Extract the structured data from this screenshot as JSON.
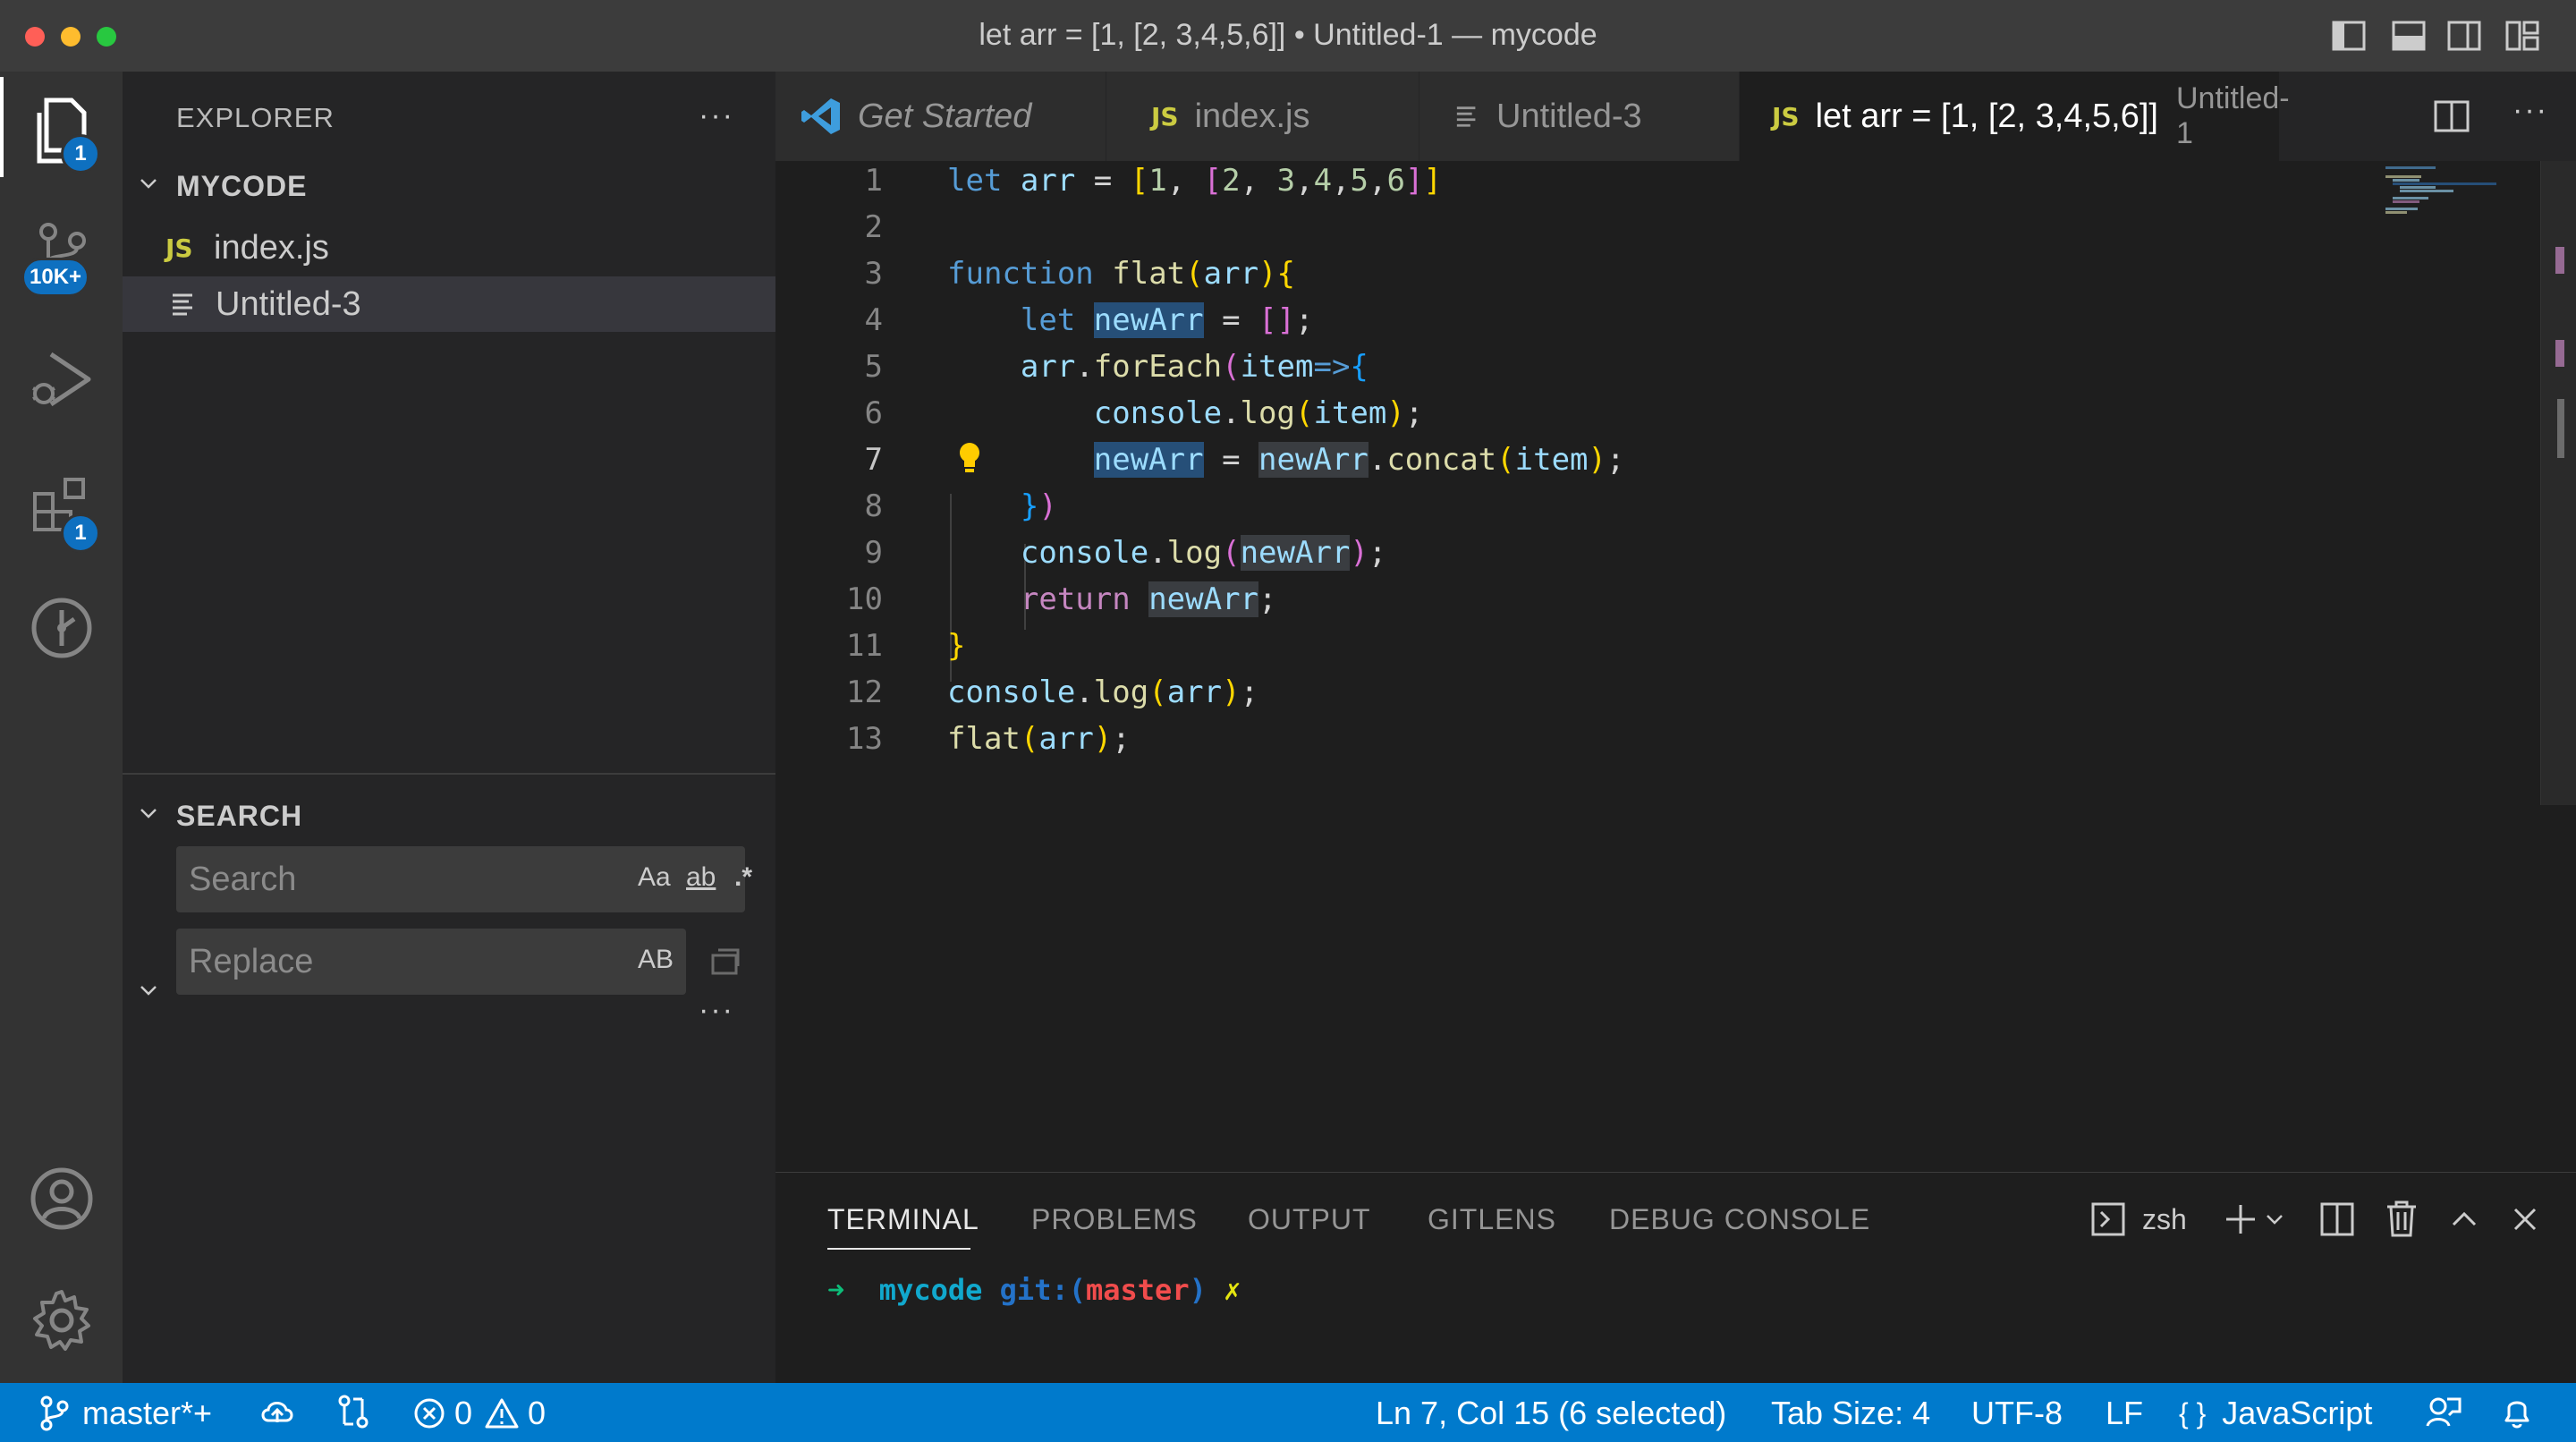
{
  "window": {
    "title": "let arr = [1, [2, 3,4,5,6]] • Untitled-1 — mycode"
  },
  "activity_bar": {
    "explorer_badge": "1",
    "scm_badge": "10K+",
    "extensions_badge": "1"
  },
  "sidebar": {
    "explorer_title": "EXPLORER",
    "folder_name": "MYCODE",
    "files": [
      {
        "name": "index.js",
        "icon": "JS"
      },
      {
        "name": "Untitled-3",
        "icon": "text-lines"
      }
    ],
    "search_title": "SEARCH",
    "search_placeholder": "Search",
    "replace_placeholder": "Replace",
    "search_options": {
      "match_case": "Aa",
      "whole_word": "ab",
      "regex": ".*"
    },
    "replace_option": "AB"
  },
  "tabs": [
    {
      "label": "Get Started",
      "icon": "vscode-logo"
    },
    {
      "label": "index.js",
      "icon": "JS"
    },
    {
      "label": "Untitled-3",
      "icon": "text-lines"
    },
    {
      "label": "let arr = [1, [2, 3,4,5,6]]",
      "description": "Untitled-1",
      "icon": "JS",
      "dirty": true
    }
  ],
  "editor": {
    "current_line": 7,
    "line_numbers": [
      "1",
      "2",
      "3",
      "4",
      "5",
      "6",
      "7",
      "8",
      "9",
      "10",
      "11",
      "12",
      "13"
    ]
  },
  "panel": {
    "tabs": [
      "TERMINAL",
      "PROBLEMS",
      "OUTPUT",
      "GITLENS",
      "DEBUG CONSOLE"
    ],
    "shell": "zsh",
    "prompt": {
      "arrow": "➜",
      "dir": "mycode",
      "git": "git:(",
      "branch": "master",
      "close": ")",
      "dirty": "✗"
    }
  },
  "statusbar": {
    "branch": "master*+",
    "errors": "0",
    "warnings": "0",
    "position": "Ln 7, Col 15 (6 selected)",
    "tab_size": "Tab Size: 4",
    "encoding": "UTF-8",
    "eol": "LF",
    "language": "JavaScript"
  },
  "colors": {
    "statusbar": "#007acc",
    "activitybar": "#333333",
    "sidebar": "#252526",
    "editor": "#1e1e1e",
    "titlebar": "#3c3c3c"
  }
}
